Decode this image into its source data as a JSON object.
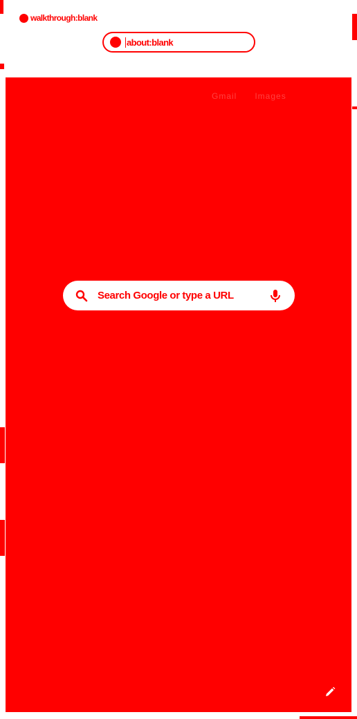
{
  "tab": {
    "title": "walkthrough:blank"
  },
  "address_bar": {
    "url": "about:blank"
  },
  "top_links": {
    "gmail": "Gmail",
    "images": "Images"
  },
  "search": {
    "placeholder": "Search Google or type a URL"
  },
  "icons": {
    "tab_favicon": "globe-icon",
    "secure": "site-info-icon",
    "search": "search-icon",
    "mic": "microphone-icon",
    "edit": "pencil-icon"
  },
  "colors": {
    "accent": "#ff0000",
    "surface": "#ffffff"
  }
}
